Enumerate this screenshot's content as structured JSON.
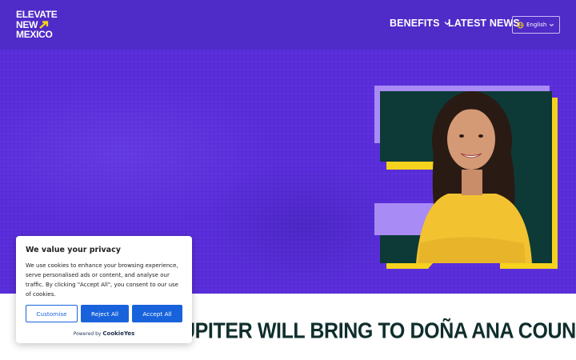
{
  "header": {
    "logo_lines": [
      "ELEVATE",
      "NEW",
      "MEXICO"
    ],
    "nav": [
      {
        "label": "BENEFITS",
        "has_dropdown": true
      },
      {
        "label": "LATEST NEWS",
        "has_dropdown": false
      }
    ],
    "language": {
      "label": "English",
      "icon": "globe-icon"
    }
  },
  "hero": {
    "headline": "UPITER WILL BRING TO DOÑA ANA COUNTY"
  },
  "cookie_banner": {
    "title": "We value your privacy",
    "body": "We use cookies to enhance your browsing experience, serve personalised ads or content, and analyse our traffic. By clicking \"Accept All\", you consent to our use of cookies.",
    "buttons": {
      "customise": "Customise",
      "reject": "Reject All",
      "accept": "Accept All"
    },
    "powered_by": "Powered by",
    "brand": "CookieYes"
  },
  "colors": {
    "header_bg": "#4f2bc7",
    "hero_bg": "#5b2fdc",
    "accent_yellow": "#f5d21c",
    "dark_green": "#0f2e2c",
    "button_blue": "#1863dc"
  }
}
